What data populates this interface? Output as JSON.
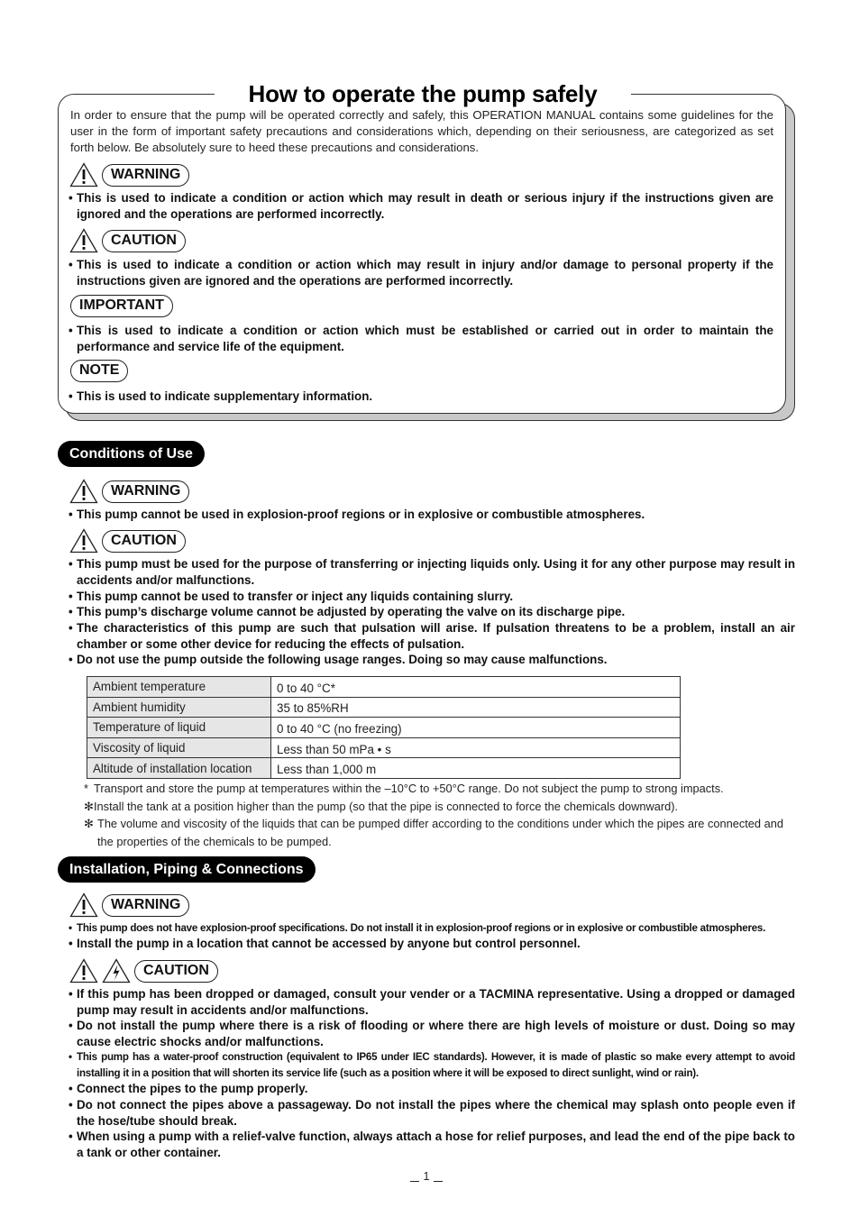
{
  "intro": {
    "title": "How to operate the pump safely",
    "text": "In order to ensure that the pump will be operated correctly and safely, this OPERATION MANUAL contains some guidelines for the user in the form of important safety precautions and considerations which, depending on their seriousness, are categorized as set forth below. Be absolutely sure to heed these precautions and considerations.",
    "categories": [
      {
        "label": "WARNING",
        "icon": "warning-triangle-icon",
        "text": "This is used to indicate a condition or action which may result in death or serious injury if the instructions given are ignored and the operations are performed incorrectly."
      },
      {
        "label": "CAUTION",
        "icon": "warning-triangle-icon",
        "text": "This is used to indicate a condition or action which may result in injury and/or damage to personal property if the instructions given are ignored and the operations are performed incorrectly."
      },
      {
        "label": "IMPORTANT",
        "icon": null,
        "text": "This is used to indicate a condition or action which must be established or carried out in order to maintain the performance and service life of the equipment."
      },
      {
        "label": "NOTE",
        "icon": null,
        "text": "This is used to indicate supplementary information."
      }
    ]
  },
  "bullet_char": "•",
  "conditions": {
    "title": "Conditions of Use",
    "warning": {
      "label": "WARNING",
      "items": [
        "This pump cannot be used in explosion-proof regions or in explosive or combustible atmospheres."
      ]
    },
    "caution": {
      "label": "CAUTION",
      "items": [
        "This pump must be used for the purpose of transferring or injecting liquids only. Using it for any other purpose may result in accidents and/or malfunctions.",
        "This pump cannot be used to transfer or inject any liquids containing slurry.",
        "This pump’s discharge volume cannot be adjusted by operating the valve on its discharge pipe.",
        "The characteristics of this pump are such that pulsation will arise.  If pulsation threatens to be a problem, install an air chamber or some other device for reducing the effects of pulsation.",
        "Do not use the pump outside the following usage ranges. Doing so may cause malfunctions."
      ]
    },
    "usage_table": [
      {
        "key": "Ambient temperature",
        "value": "0 to 40 °C*"
      },
      {
        "key": "Ambient humidity",
        "value": "35 to 85%RH"
      },
      {
        "key": "Temperature of liquid",
        "value": "0 to 40 °C (no freezing)"
      },
      {
        "key": "Viscosity of liquid",
        "value": "Less than 50 mPa • s"
      },
      {
        "key": "Altitude of installation location",
        "value": "Less than 1,000 m"
      }
    ],
    "footnotes": [
      {
        "mark": "*",
        "text": "Transport and store the pump at temperatures within the –10°C to +50°C range. Do not subject the pump to strong impacts."
      },
      {
        "mark": "✻",
        "text": "Install the tank at a position higher than the pump (so that the pipe is connected to force the chemicals downward)."
      },
      {
        "mark": "✻",
        "text": "The volume and viscosity of the liquids that can be pumped differ according to the conditions under which the pipes are connected and the properties of the chemicals to be pumped."
      }
    ]
  },
  "installation": {
    "title": "Installation, Piping & Connections",
    "warning": {
      "label": "WARNING",
      "items": [
        "This pump does not have explosion-proof specifications. Do not install it in explosion-proof regions or in explosive or combustible atmospheres.",
        "Install the pump in a location that cannot be accessed by anyone but control personnel."
      ]
    },
    "caution": {
      "label": "CAUTION",
      "icons": [
        "warning-triangle-icon",
        "electric-shock-icon"
      ],
      "items": [
        "If this pump has been dropped or damaged, consult your vender or a TACMINA representative. Using a dropped or damaged pump may result in accidents and/or malfunctions.",
        "Do not install the pump where there is a risk of flooding or where there are high levels of moisture or dust. Doing so may cause electric shocks and/or malfunctions.",
        "This pump has a water-proof construction (equivalent to IP65 under IEC standards).  However, it is made of plastic so make every attempt to avoid installing it in a position that will shorten its service life (such as a position where it will be exposed to direct sunlight, wind or rain).",
        "Connect the pipes to the pump properly.",
        "Do not connect the pipes above a passageway. Do not install the pipes where the chemical may splash onto people even if the hose/tube should break.",
        "When using a pump with a relief-valve function, always attach a hose for relief purposes, and lead the end of the pipe back to a tank or other container."
      ]
    }
  },
  "page_number": "1"
}
